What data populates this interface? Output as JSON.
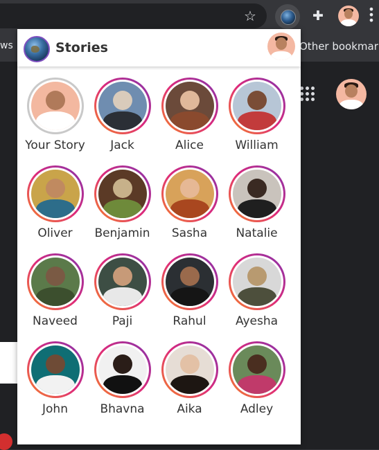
{
  "browser": {
    "bookmark_left_fragment": "ws",
    "bookmark_right": "Other bookmark"
  },
  "icons": {
    "star": "star-icon",
    "extension_active": "globe-icon",
    "extensions": "puzzle-icon",
    "profile": "avatar",
    "menu": "more-vert-icon",
    "apps": "apps-grid-icon"
  },
  "popup": {
    "title": "Stories",
    "accent_gradient": [
      "#f58529",
      "#dd2a7b",
      "#8134af"
    ],
    "stories": [
      {
        "name": "Your Story",
        "self": true,
        "bg": "#f3b8a0",
        "head": "#b07a5a",
        "body": "#ffffff"
      },
      {
        "name": "Jack",
        "self": false,
        "bg": "#6f8db0",
        "head": "#d9cbbb",
        "body": "#2b2f36"
      },
      {
        "name": "Alice",
        "self": false,
        "bg": "#6b4a3a",
        "head": "#e0b89a",
        "body": "#8a4a2e"
      },
      {
        "name": "William",
        "self": false,
        "bg": "#b7c6d6",
        "head": "#7a4d36",
        "body": "#c23b3b"
      },
      {
        "name": "Oliver",
        "self": false,
        "bg": "#c9a44a",
        "head": "#c08a60",
        "body": "#2d6d8a"
      },
      {
        "name": "Benjamin",
        "self": false,
        "bg": "#5b3a26",
        "head": "#c7b18a",
        "body": "#6e8a3a"
      },
      {
        "name": "Sasha",
        "self": false,
        "bg": "#d8a25a",
        "head": "#e6b895",
        "body": "#a9471f"
      },
      {
        "name": "Natalie",
        "self": false,
        "bg": "#c9c3bc",
        "head": "#3a2a22",
        "body": "#1f1f1f"
      },
      {
        "name": "Naveed",
        "self": false,
        "bg": "#5b7a4a",
        "head": "#7a5a44",
        "body": "#3c4f2e"
      },
      {
        "name": "Paji",
        "self": false,
        "bg": "#3d4e44",
        "head": "#c79a78",
        "body": "#e8e8e8"
      },
      {
        "name": "Rahul",
        "self": false,
        "bg": "#2b2f33",
        "head": "#9a6a4c",
        "body": "#151515"
      },
      {
        "name": "Ayesha",
        "self": false,
        "bg": "#d8d8d8",
        "head": "#b89a70",
        "body": "#4d4f3c"
      },
      {
        "name": "John",
        "self": false,
        "bg": "#0f6e74",
        "head": "#6e4b36",
        "body": "#f2f2f2"
      },
      {
        "name": "Bhavna",
        "self": false,
        "bg": "#f1f1f1",
        "head": "#2a1d18",
        "body": "#111111"
      },
      {
        "name": "Aika",
        "self": false,
        "bg": "#e6ddd5",
        "head": "#e3c1a6",
        "body": "#1d1612"
      },
      {
        "name": "Adley",
        "self": false,
        "bg": "#6a8a5a",
        "head": "#4a2e20",
        "body": "#c03a6a"
      }
    ]
  }
}
